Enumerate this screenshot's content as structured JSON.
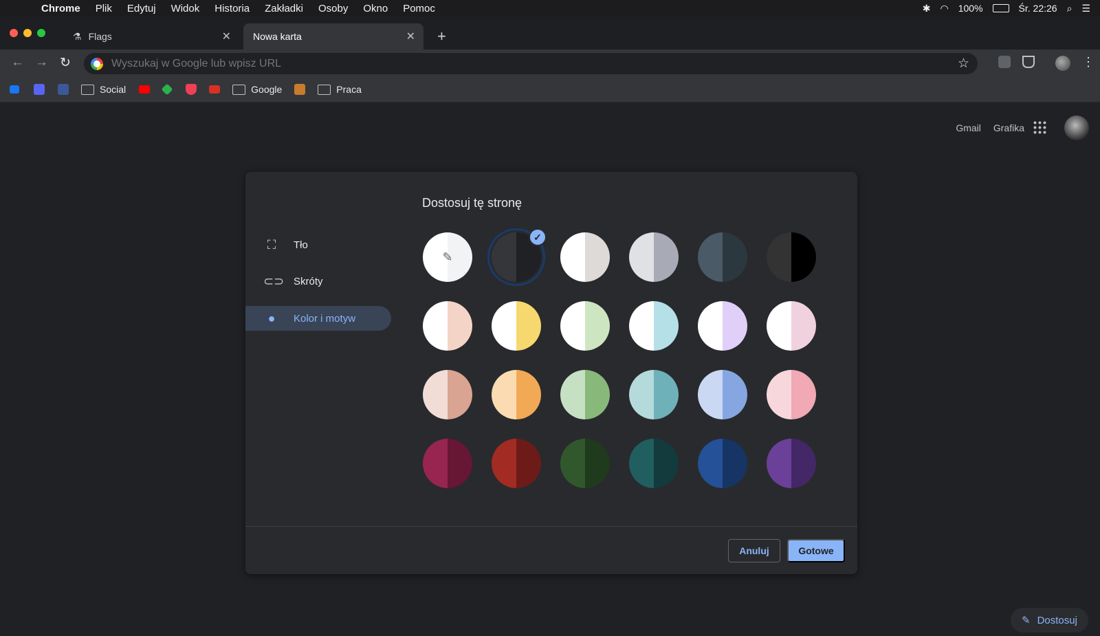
{
  "menubar": {
    "app": "Chrome",
    "items": [
      "Plik",
      "Edytuj",
      "Widok",
      "Historia",
      "Zakładki",
      "Osoby",
      "Okno",
      "Pomoc"
    ],
    "battery": "100%",
    "clock": "Śr. 22:26"
  },
  "tabs": [
    {
      "title": "Flags",
      "icon": "flask-icon"
    },
    {
      "title": "Nowa karta",
      "icon": ""
    }
  ],
  "omnibox": {
    "placeholder": "Wyszukaj w Google lub wpisz URL"
  },
  "bookmarks": [
    {
      "type": "favicon",
      "name": "bookmark-favicon-1",
      "color": "#1877f2"
    },
    {
      "type": "favicon",
      "name": "discord-icon",
      "color": "#5865f2"
    },
    {
      "type": "favicon",
      "name": "facebook-icon",
      "color": "#3b5998"
    },
    {
      "type": "folder",
      "label": "Social"
    },
    {
      "type": "favicon",
      "name": "youtube-icon",
      "color": "#ff0000"
    },
    {
      "type": "favicon",
      "name": "feedly-icon",
      "color": "#2bb24c"
    },
    {
      "type": "favicon",
      "name": "pocket-icon",
      "color": "#ef4056"
    },
    {
      "type": "favicon",
      "name": "gmail-icon",
      "color": "#d93025"
    },
    {
      "type": "folder",
      "label": "Google"
    },
    {
      "type": "favicon",
      "name": "bookmark-favicon-image",
      "color": "#c97b2d"
    },
    {
      "type": "folder",
      "label": "Praca"
    }
  ],
  "page": {
    "gmail": "Gmail",
    "images": "Grafika",
    "customize": "Dostosuj"
  },
  "dialog": {
    "title": "Dostosuj tę stronę",
    "sidebar": [
      {
        "label": "Tło",
        "icon": "background-icon"
      },
      {
        "label": "Skróty",
        "icon": "link-icon"
      },
      {
        "label": "Kolor i motyw",
        "icon": "palette-icon",
        "selected": true
      }
    ],
    "cancel": "Anuluj",
    "done": "Gotowe"
  },
  "colors": {
    "accent": "#8ab4f8",
    "background": "#202124",
    "dialog": "#292a2d"
  },
  "swatches": [
    {
      "left": "#ffffff",
      "right": "#f1f3f4",
      "picker": true
    },
    {
      "left": "#35363a",
      "right": "#202124",
      "selected": true
    },
    {
      "left": "#ffffff",
      "right": "#dedad8"
    },
    {
      "left": "#e0e1e5",
      "right": "#a8abb6"
    },
    {
      "left": "#4a5a66",
      "right": "#2c3840"
    },
    {
      "left": "#333333",
      "right": "#000000"
    },
    {
      "left": "#ffffff",
      "right": "#f4d4c6"
    },
    {
      "left": "#ffffff",
      "right": "#f7d86f"
    },
    {
      "left": "#ffffff",
      "right": "#cde6c1"
    },
    {
      "left": "#ffffff",
      "right": "#b5e0e8"
    },
    {
      "left": "#ffffff",
      "right": "#e0cff8"
    },
    {
      "left": "#ffffff",
      "right": "#f0d2de"
    },
    {
      "left": "#f2ddd6",
      "right": "#d9a492"
    },
    {
      "left": "#fbdcb2",
      "right": "#f2a956"
    },
    {
      "left": "#c6e0c3",
      "right": "#89b87b"
    },
    {
      "left": "#b5dadb",
      "right": "#6fb1b8"
    },
    {
      "left": "#cbd8f4",
      "right": "#86a6e2"
    },
    {
      "left": "#f7d7dc",
      "right": "#f0a9b5"
    },
    {
      "left": "#972550",
      "right": "#671634"
    },
    {
      "left": "#a22b24",
      "right": "#6d1b19"
    },
    {
      "left": "#31582c",
      "right": "#203a1d"
    },
    {
      "left": "#205e60",
      "right": "#133a3d"
    },
    {
      "left": "#245197",
      "right": "#163564"
    },
    {
      "left": "#6a4098",
      "right": "#432767"
    }
  ]
}
